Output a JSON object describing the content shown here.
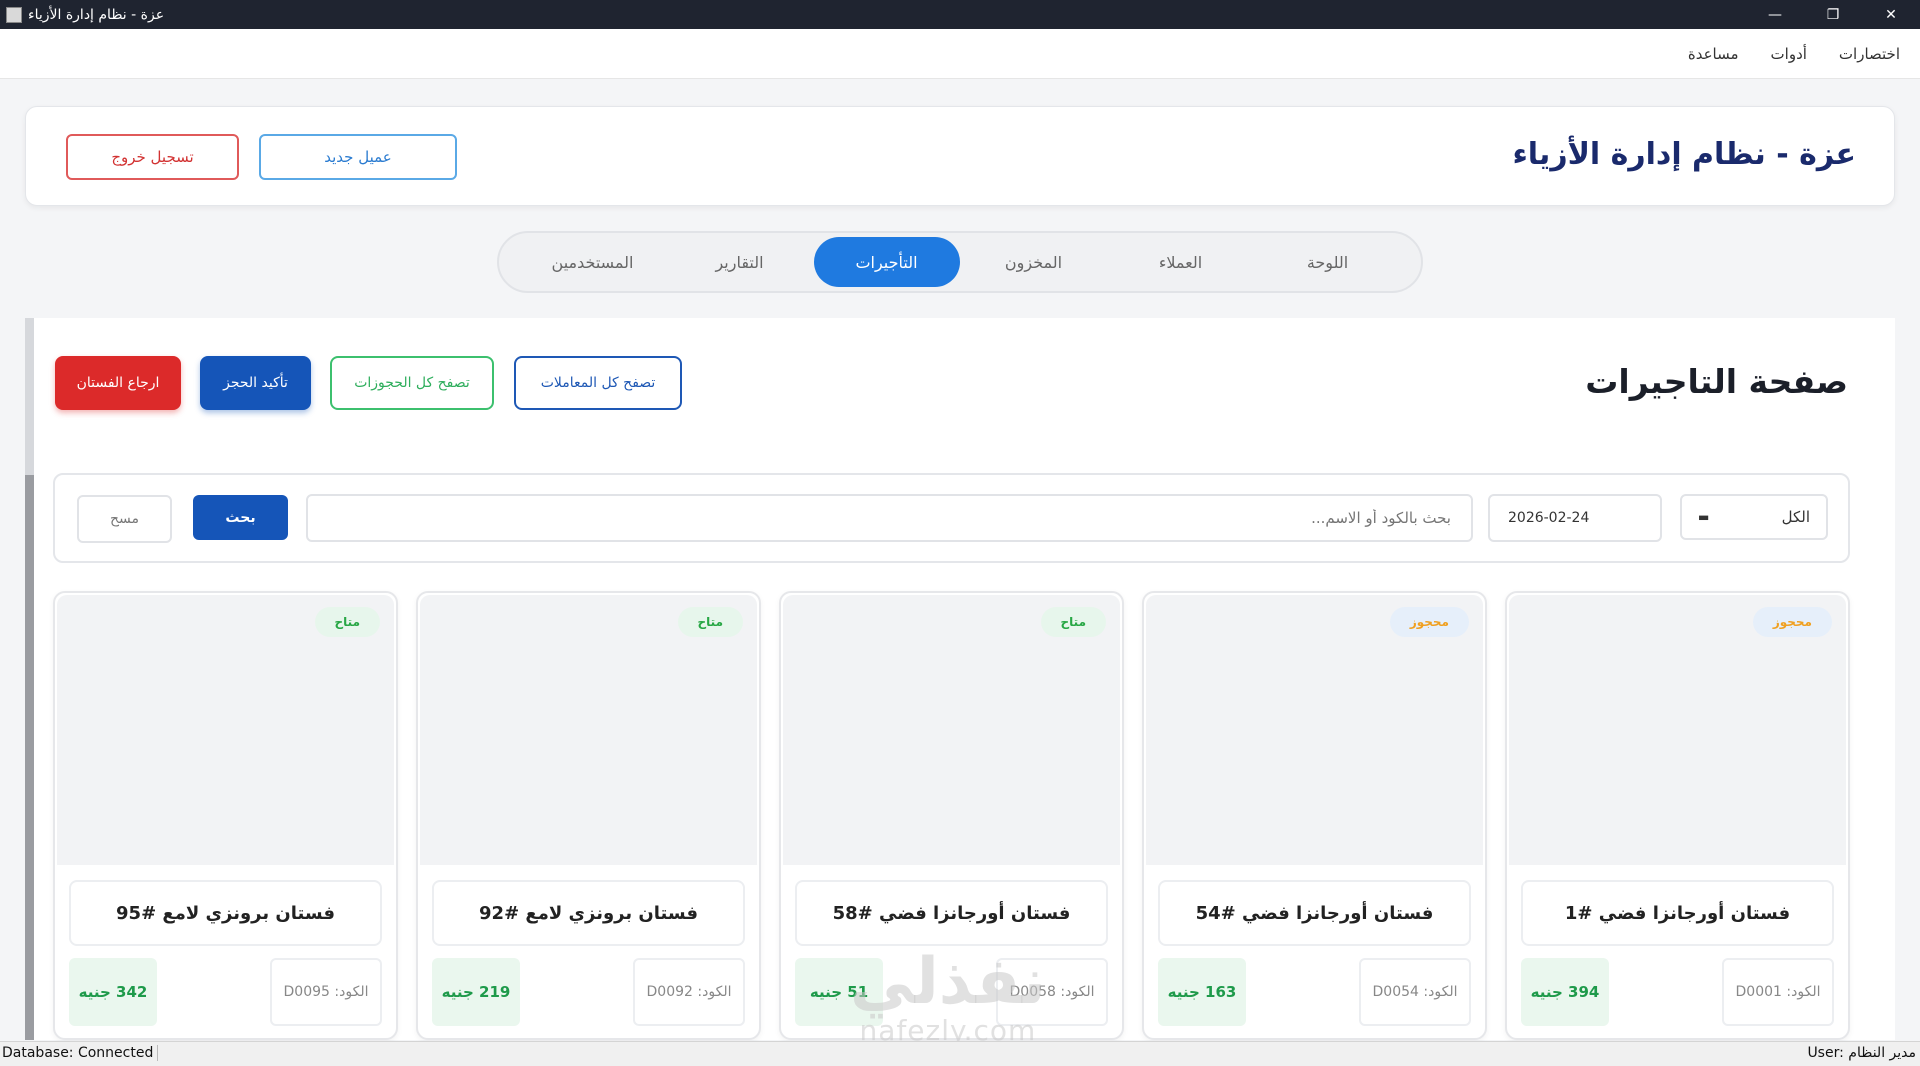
{
  "window": {
    "title": "عزة - نظام إدارة الأزياء",
    "controls": {
      "minimize": "—",
      "restore": "❐",
      "close": "✕"
    }
  },
  "menubar": {
    "items": [
      "اختصارات",
      "أدوات",
      "مساعدة"
    ]
  },
  "header": {
    "app_title": "عزة - نظام إدارة الأزياء",
    "new_client_label": "عميل جديد",
    "logout_label": "تسجيل خروج"
  },
  "tabs": [
    {
      "label": "اللوحة",
      "active": false
    },
    {
      "label": "العملاء",
      "active": false
    },
    {
      "label": "المخزون",
      "active": false
    },
    {
      "label": "التأجيرات",
      "active": true
    },
    {
      "label": "التقارير",
      "active": false
    },
    {
      "label": "المستخدمين",
      "active": false
    }
  ],
  "page": {
    "title": "صفحة التاجيرات",
    "actions": {
      "browse_transactions": "تصفح كل المعاملات",
      "browse_bookings": "تصفح كل الحجوزات",
      "confirm_booking": "تأكيد الحجز",
      "return_dress": "ارجاع الفستان"
    }
  },
  "search": {
    "filter_value": "الكل",
    "date_value": "2026-02-24",
    "placeholder": "بحث بالكود أو الاسم...",
    "search_label": "بحث",
    "clear_label": "مسح"
  },
  "cards": [
    {
      "name": "فستان أورجانزا فضي #1",
      "code": "الكود: D0001",
      "price": "394 جنيه",
      "status": "محجوز",
      "status_type": "reserved"
    },
    {
      "name": "فستان أورجانزا فضي #54",
      "code": "الكود: D0054",
      "price": "163 جنيه",
      "status": "محجوز",
      "status_type": "reserved"
    },
    {
      "name": "فستان أورجانزا فضي #58",
      "code": "الكود: D0058",
      "price": "51 جنيه",
      "status": "متاح",
      "status_type": "available"
    },
    {
      "name": "فستان برونزي لامع #92",
      "code": "الكود: D0092",
      "price": "219 جنيه",
      "status": "متاح",
      "status_type": "available"
    },
    {
      "name": "فستان برونزي لامع #95",
      "code": "الكود: D0095",
      "price": "342 جنيه",
      "status": "متاح",
      "status_type": "available"
    }
  ],
  "statusbar": {
    "db_status": "Database: Connected",
    "user_status": "User: مدير النظام"
  },
  "watermark": {
    "main": "نفذلي",
    "sub": "nafezly.com"
  },
  "colors": {
    "accent": "#1f7ae0",
    "primary_button": "#1555b8",
    "danger": "#dc2a2a",
    "success": "#28a745",
    "reserved": "#f0a020",
    "heading": "#1a2a6c"
  }
}
